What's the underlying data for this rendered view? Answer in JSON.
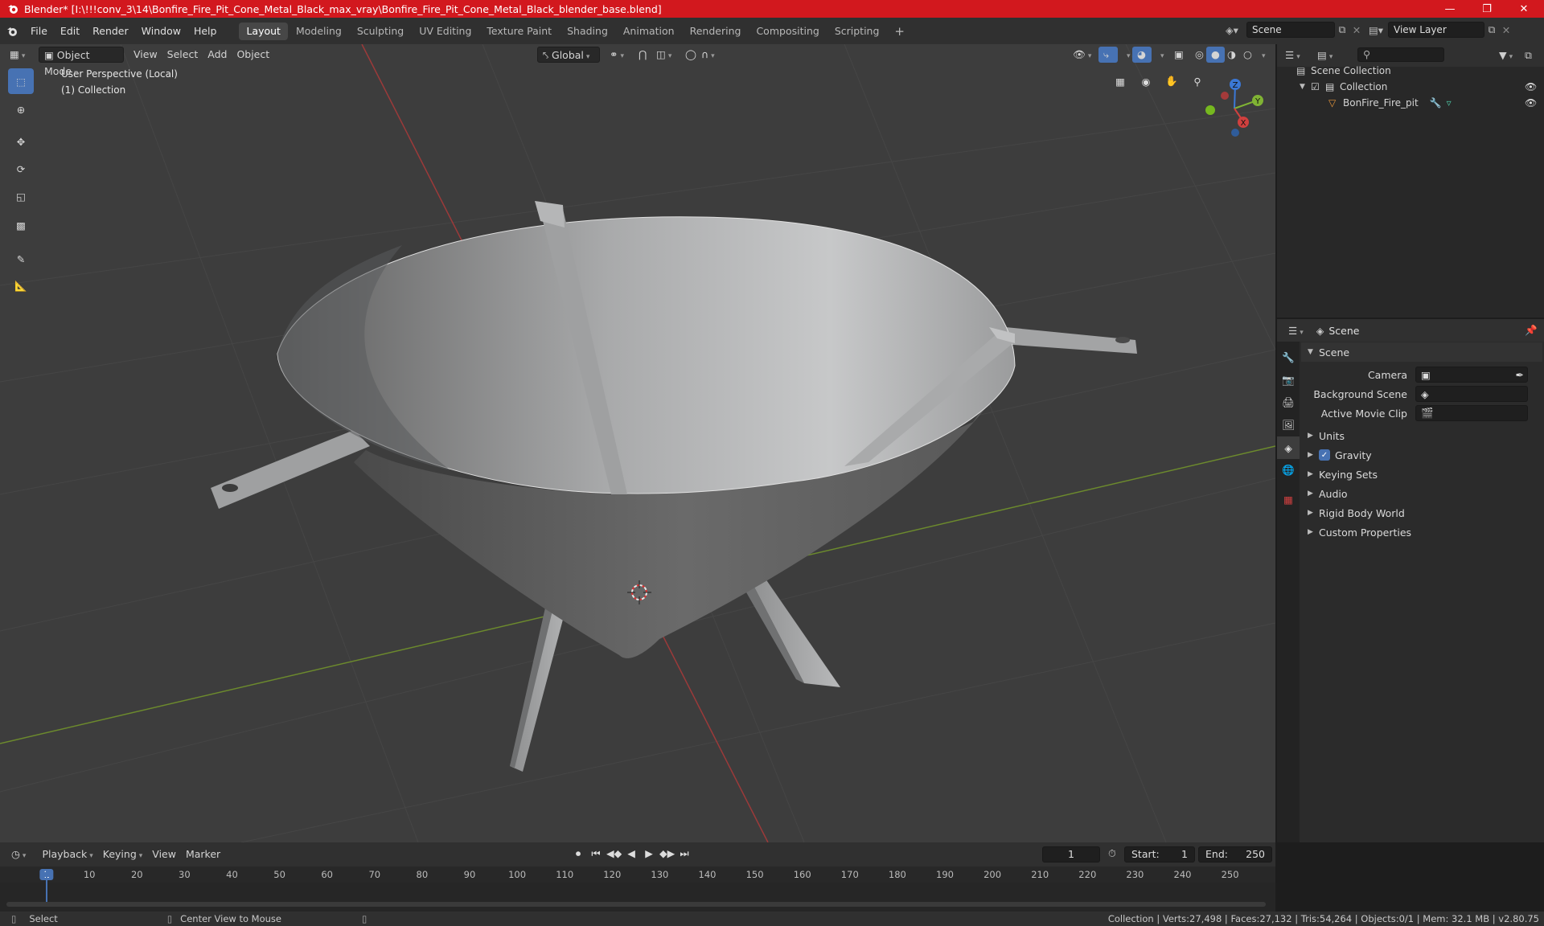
{
  "window": {
    "title": "Blender* [I:\\!!!conv_3\\14\\Bonfire_Fire_Pit_Cone_Metal_Black_max_vray\\Bonfire_Fire_Pit_Cone_Metal_Black_blender_base.blend]",
    "title_bar_color": "#d2181e"
  },
  "menus": [
    "File",
    "Edit",
    "Render",
    "Window",
    "Help"
  ],
  "workspaces": [
    "Layout",
    "Modeling",
    "Sculpting",
    "UV Editing",
    "Texture Paint",
    "Shading",
    "Animation",
    "Rendering",
    "Compositing",
    "Scripting"
  ],
  "active_workspace": "Layout",
  "scene_selector": {
    "value": "Scene"
  },
  "view_layer_selector": {
    "value": "View Layer"
  },
  "viewport_header": {
    "mode": "Object Mode",
    "menus": [
      "View",
      "Select",
      "Add",
      "Object"
    ],
    "transform_orientation": "Global"
  },
  "viewport": {
    "perspective_label": "User Perspective (Local)",
    "collection_label": "(1) Collection",
    "gizmo_axes": {
      "x": "X",
      "y": "Y",
      "z": "Z"
    },
    "axis_colors": {
      "x": "#d0403e",
      "y": "#80b334",
      "z": "#3b78d6"
    }
  },
  "outliner": {
    "root": "Scene Collection",
    "collection": "Collection",
    "object": "BonFire_Fire_pit"
  },
  "properties": {
    "header_title": "Scene",
    "panel_title": "Scene",
    "fields": {
      "camera": "Camera",
      "background_scene": "Background Scene",
      "active_movie_clip": "Active Movie Clip"
    },
    "sections": [
      "Units",
      "Gravity",
      "Keying Sets",
      "Audio",
      "Rigid Body World",
      "Custom Properties"
    ],
    "gravity_checked": true
  },
  "timeline": {
    "menus": [
      "Playback",
      "Keying",
      "View",
      "Marker"
    ],
    "current_frame": "1",
    "start_label": "Start:",
    "start_value": "1",
    "end_label": "End:",
    "end_value": "250",
    "ruler_ticks": [
      "1",
      "10",
      "20",
      "30",
      "40",
      "50",
      "60",
      "70",
      "80",
      "90",
      "100",
      "110",
      "120",
      "130",
      "140",
      "150",
      "160",
      "170",
      "180",
      "190",
      "200",
      "210",
      "220",
      "230",
      "240",
      "250"
    ]
  },
  "statusbar": {
    "left_action": "Select",
    "middle_action": "Center View to Mouse",
    "stats": "Collection | Verts:27,498 | Faces:27,132 | Tris:54,264 | Objects:0/1 | Mem: 32.1 MB | v2.80.75"
  }
}
